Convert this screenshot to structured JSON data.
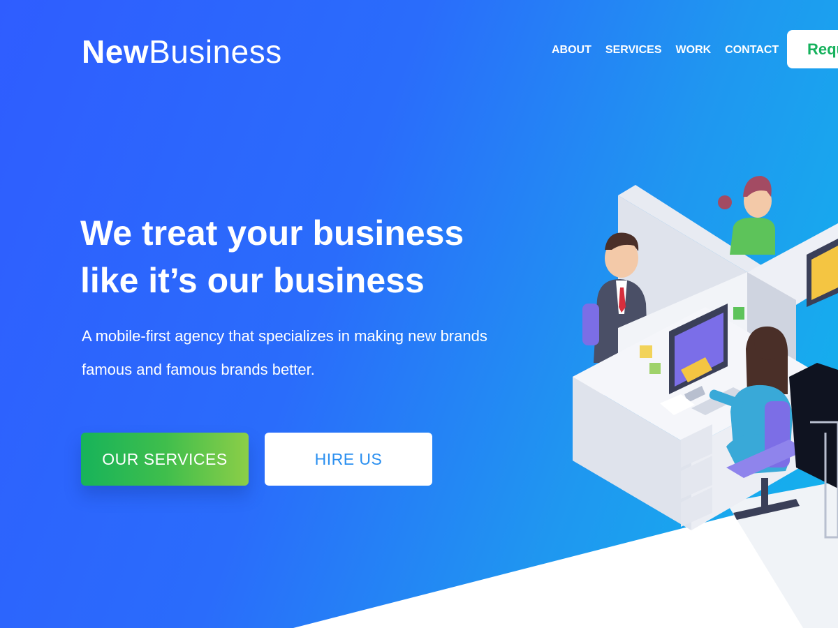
{
  "brand": {
    "bold": "New",
    "light": "Business"
  },
  "nav": {
    "items": [
      {
        "label": "ABOUT"
      },
      {
        "label": "SERVICES"
      },
      {
        "label": "WORK"
      },
      {
        "label": "CONTACT"
      }
    ],
    "cta_label": "Request"
  },
  "hero": {
    "headline_line1": "We treat your business",
    "headline_line2": "like it’s our business",
    "subtext_line1": "A mobile-first agency that specializes in making new brands",
    "subtext_line2": "famous and famous brands better.",
    "primary_button": "OUR SERVICES",
    "secondary_button": "HIRE US"
  },
  "colors": {
    "gradient_start": "#2f5dff",
    "gradient_end": "#12b6ec",
    "accent_green": "#17b35a",
    "accent_blue": "#2a8ff0",
    "white": "#ffffff"
  },
  "illustration": {
    "icon": "office-cubicle-illustration"
  }
}
